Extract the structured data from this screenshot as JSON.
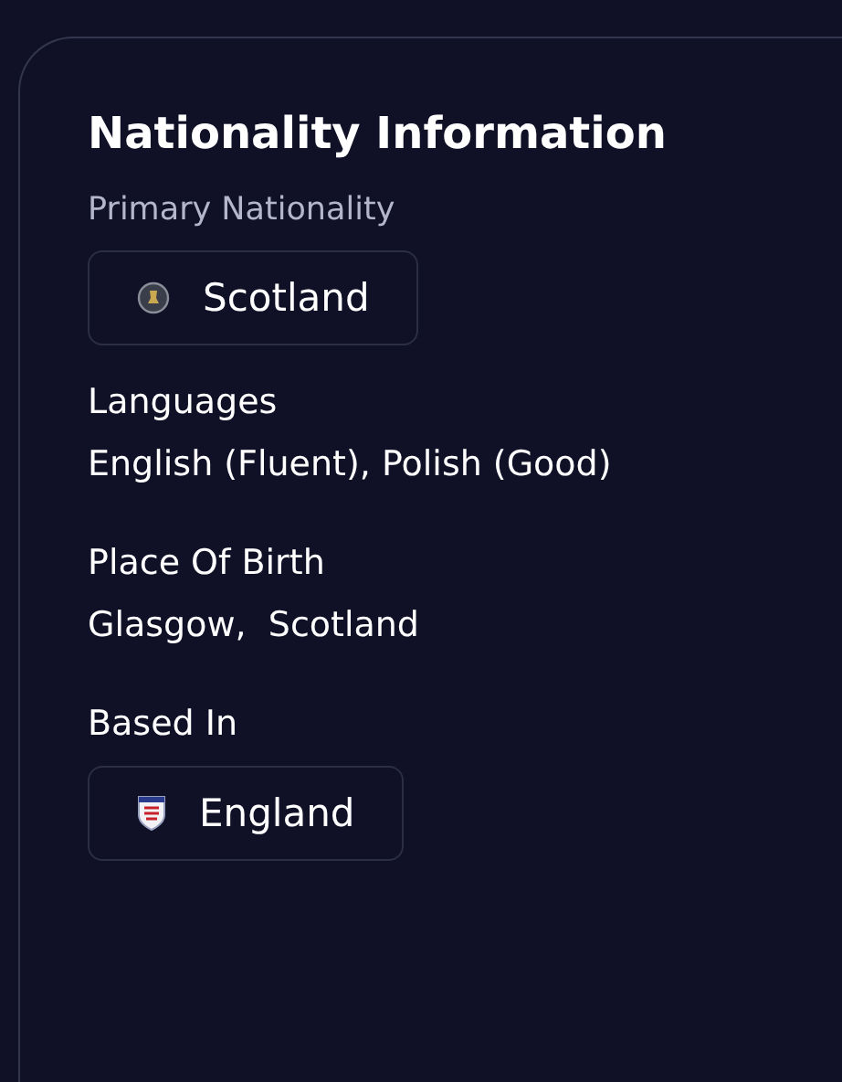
{
  "title": "Nationality Information",
  "fields": [
    {
      "kind": "chip",
      "label": "Primary Nationality",
      "value": "Scotland"
    },
    {
      "kind": "text",
      "label": "Languages",
      "value": "English (Fluent), Polish (Good)"
    },
    {
      "kind": "text",
      "label": "Place Of Birth",
      "value": "Glasgow,  Scotland"
    },
    {
      "kind": "chip",
      "label": "Based In",
      "value": "England"
    }
  ]
}
